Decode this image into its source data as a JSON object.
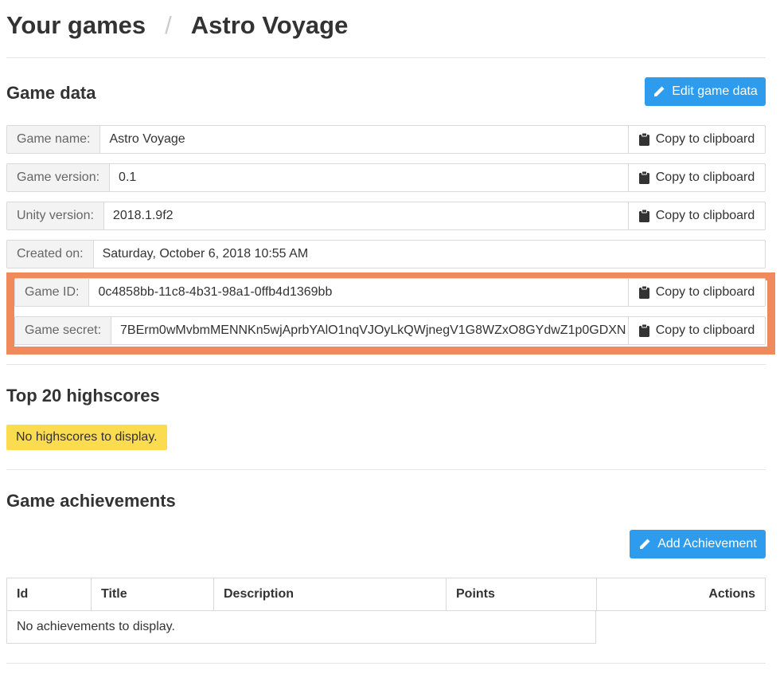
{
  "breadcrumb": {
    "root": "Your games",
    "separator": "/",
    "current": "Astro Voyage"
  },
  "game_data": {
    "title": "Game data",
    "edit_button": "Edit game data",
    "copy_label": "Copy to clipboard",
    "fields": [
      {
        "label": "Game name:",
        "value": "Astro Voyage",
        "copyable": true
      },
      {
        "label": "Game version:",
        "value": "0.1",
        "copyable": true
      },
      {
        "label": "Unity version:",
        "value": "2018.1.9f2",
        "copyable": true
      },
      {
        "label": "Created on:",
        "value": "Saturday, October 6, 2018 10:55 AM",
        "copyable": false
      },
      {
        "label": "Game ID:",
        "value": "0c4858bb-11c8-4b31-98a1-0ffb4d1369bb",
        "copyable": true
      },
      {
        "label": "Game secret:",
        "value": "7BErm0wMvbmMENNKn5wjAprbYAlO1nqVJOyLkQWjnegV1G8WZxO8GYdwZ1p0GDXN",
        "copyable": true
      }
    ]
  },
  "highscores": {
    "title": "Top 20 highscores",
    "empty_message": "No highscores to display."
  },
  "achievements": {
    "title": "Game achievements",
    "add_button": "Add Achievement",
    "columns": [
      "Id",
      "Title",
      "Description",
      "Points",
      "Actions"
    ],
    "empty_message": "No achievements to display."
  },
  "colors": {
    "primary": "#2d9cee",
    "highlight": "#f08a5c",
    "warning": "#fbdc51"
  },
  "icons": {
    "edit": "pencil-icon",
    "copy": "clipboard-icon"
  }
}
